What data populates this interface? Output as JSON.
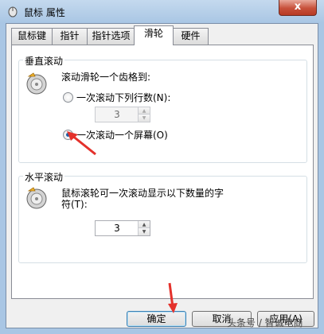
{
  "window": {
    "title": "鼠标 属性",
    "close_label": "x"
  },
  "tabs": [
    {
      "label": "鼠标键"
    },
    {
      "label": "指针"
    },
    {
      "label": "指针选项"
    },
    {
      "label": "滑轮",
      "active": true
    },
    {
      "label": "硬件"
    }
  ],
  "vertical_scroll": {
    "group_title": "垂直滚动",
    "description": "滚动滑轮一个齿格到:",
    "option_lines": {
      "label": "一次滚动下列行数(N):",
      "selected": false
    },
    "lines_value": "3",
    "option_screen": {
      "label": "一次滚动一个屏幕(O)",
      "selected": true
    }
  },
  "horizontal_scroll": {
    "group_title": "水平滚动",
    "description_line1": "鼠标滚轮可一次滚动显示以下数量的字",
    "description_line2": "符(T):",
    "chars_value": "3"
  },
  "buttons": {
    "ok": "确定",
    "cancel": "取消",
    "apply": "应用(A)"
  },
  "watermark": "头条号 / 智诚电商",
  "colors": {
    "annotation_arrow": "#e4312b",
    "window_frame": "#a9c6e4",
    "close_button": "#c7503a"
  },
  "icons": {
    "title": "mouse-properties-icon",
    "wheel": "mouse-wheel-icon"
  }
}
